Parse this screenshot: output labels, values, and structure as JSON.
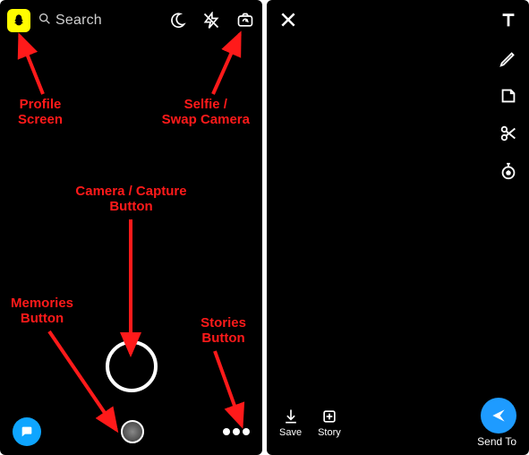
{
  "left": {
    "search_placeholder": "Search",
    "annotations": {
      "profile": "Profile\nScreen",
      "selfie": "Selfie /\nSwap Camera",
      "capture": "Camera / Capture\nButton",
      "memories": "Memories\nButton",
      "stories": "Stories\nButton"
    }
  },
  "right": {
    "save_label": "Save",
    "story_label": "Story",
    "send_label": "Send To"
  }
}
